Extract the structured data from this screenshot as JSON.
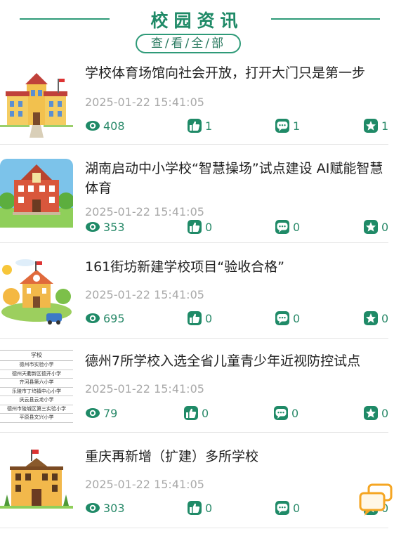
{
  "header": {
    "title": "校园资讯",
    "view_all": "查/看/全/部"
  },
  "colors": {
    "accent": "#1f8a67",
    "icon_fill": "#1f8a67",
    "time_gray": "#a8a8a8",
    "float_button": "#f5a623"
  },
  "news": [
    {
      "title": "学校体育场馆向社会开放，打开大门只是第一步",
      "time": "2025-01-22 15:41:05",
      "views": "408",
      "likes": "1",
      "comments": "1",
      "favorites": "1"
    },
    {
      "title": "湖南启动中小学校“智慧操场”试点建设 AI赋能智慧体育",
      "time": "2025-01-22 15:41:05",
      "views": "353",
      "likes": "0",
      "comments": "0",
      "favorites": "0"
    },
    {
      "title": "161街坊新建学校项目“验收合格”",
      "time": "2025-01-22 15:41:05",
      "views": "695",
      "likes": "0",
      "comments": "0",
      "favorites": "0"
    },
    {
      "title": "德州7所学校入选全省儿童青少年近视防控试点",
      "time": "2025-01-22 15:41:05",
      "views": "79",
      "likes": "0",
      "comments": "0",
      "favorites": "0",
      "thumb_list": {
        "heading": "学校",
        "rows": [
          "德州市实验小学",
          "德州天衢新区德开小学",
          "齐河县第六小学",
          "乐陵市丁坞镇中心小学",
          "庆云县云龙小学",
          "德州市陵城区第三实验小学",
          "平原县文兴小学"
        ]
      }
    },
    {
      "title": "重庆再新增（扩建）多所学校",
      "time": "2025-01-22 15:41:05",
      "views": "303",
      "likes": "0",
      "comments": "0",
      "favorites": "0"
    }
  ]
}
